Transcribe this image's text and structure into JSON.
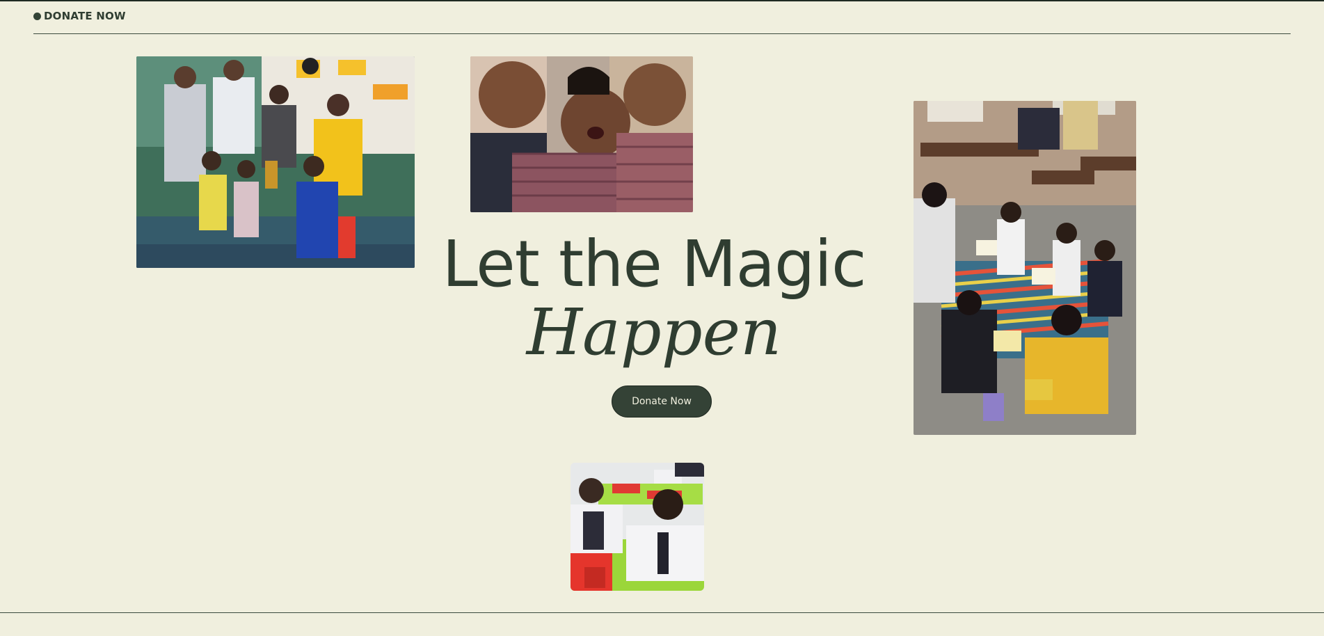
{
  "header": {
    "label": "DONATE NOW"
  },
  "hero": {
    "line1": "Let the Magic",
    "line2": "Happen",
    "button_label": "Donate Now"
  },
  "colors": {
    "background": "#f0efde",
    "text": "#2f3d31",
    "button": "#344236"
  }
}
